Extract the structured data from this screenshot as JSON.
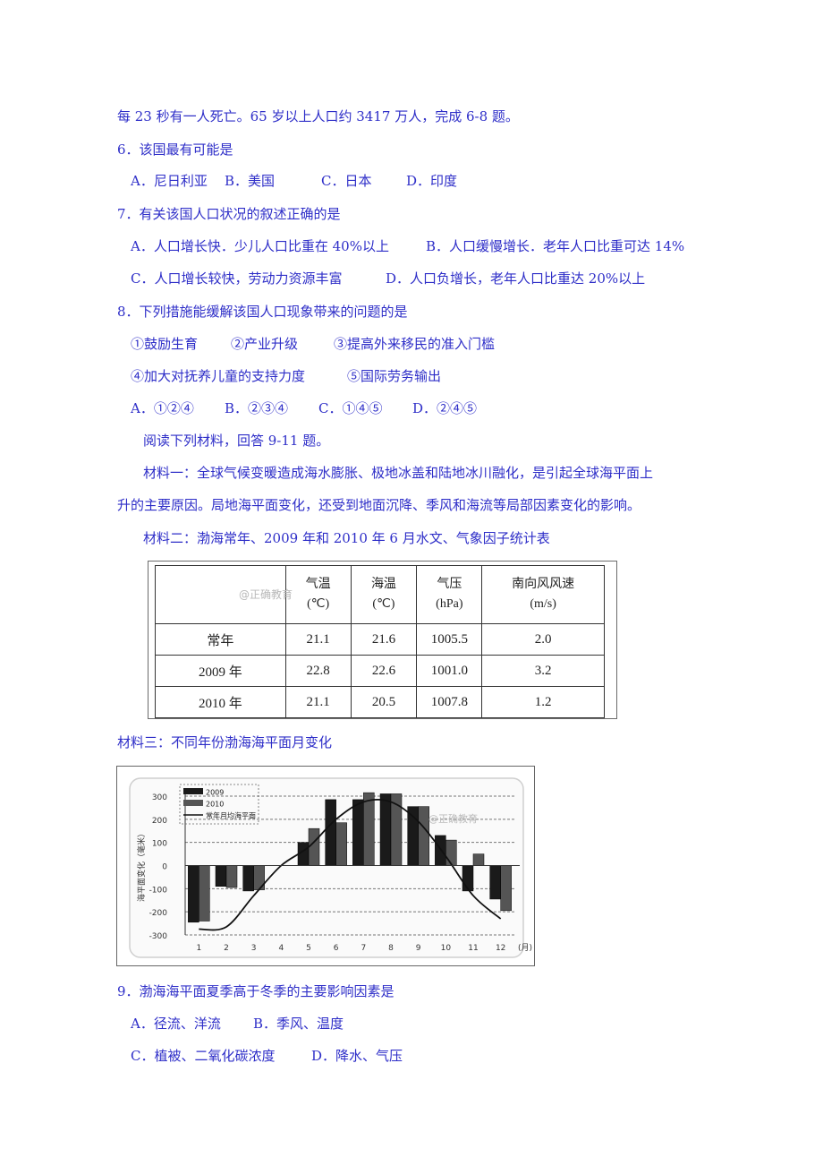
{
  "intro_line": "每 23 秒有一人死亡。65 岁以上人口约 3417 万人，完成 6-8 题。",
  "q6": {
    "stem": "6．该国最有可能是",
    "options": [
      "A．尼日利亚",
      "B．美国",
      "C．日本",
      "D．印度"
    ]
  },
  "q7": {
    "stem": "7．有关该国人口状况的叙述正确的是",
    "options": [
      "A．人口增长快．少儿人口比重在 40%以上",
      "B．人口缓慢增长．老年人口比重可达 14%",
      "C．人口增长较快，劳动力资源丰富",
      "D．人口负增长，老年人口比重达 20%以上"
    ]
  },
  "q8": {
    "stem": "8．下列措施能缓解该国人口现象带来的问题的是",
    "measures_row1": [
      "①鼓励生育",
      "②产业升级",
      "③提高外来移民的准入门槛"
    ],
    "measures_row2": [
      "④加大对抚养儿童的支持力度",
      "⑤国际劳务输出"
    ],
    "options": [
      "A．①②④",
      "B．②③④",
      "C．①④⑤",
      "D．②④⑤"
    ]
  },
  "reading_prompt": "阅读下列材料，回答 9-11 题。",
  "material1": {
    "line1": "材料一：全球气候变暖造成海水膨胀、极地冰盖和陆地冰川融化，是引起全球海平面上",
    "line2": "升的主要原因。局地海平面变化，还受到地面沉降、季风和海流等局部因素变化的影响。"
  },
  "material2": {
    "title": "材料二：渤海常年、2009 年和 2010 年 6 月水文、气象因子统计表",
    "watermark": "@正确教育",
    "headers": [
      {
        "name": "气温",
        "unit": "(℃)"
      },
      {
        "name": "海温",
        "unit": "(℃)"
      },
      {
        "name": "气压",
        "unit": "(hPa)"
      },
      {
        "name": "南向风风速",
        "unit": "(m/s)"
      }
    ],
    "rows": [
      {
        "label": "常年",
        "values": [
          "21.1",
          "21.6",
          "1005.5",
          "2.0"
        ]
      },
      {
        "label": "2009 年",
        "values": [
          "22.8",
          "22.6",
          "1001.0",
          "3.2"
        ]
      },
      {
        "label": "2010 年",
        "values": [
          "21.1",
          "20.5",
          "1007.8",
          "1.2"
        ]
      }
    ]
  },
  "material3": {
    "title": "材料三：不同年份渤海海平面月变化"
  },
  "chart_data": {
    "type": "bar",
    "title": "不同年份渤海海平面月变化",
    "xlabel": "(月)",
    "ylabel": "海平面变化（毫米）",
    "categories": [
      "1",
      "2",
      "3",
      "4",
      "5",
      "6",
      "7",
      "8",
      "9",
      "10",
      "11",
      "12"
    ],
    "ylim": [
      -300,
      300
    ],
    "yticks": [
      "300",
      "200",
      "100",
      "0",
      "-100",
      "-200",
      "-300"
    ],
    "grid": true,
    "legend_position": "top-left",
    "watermark": "@正确教育",
    "series": [
      {
        "name": "2009",
        "kind": "bar",
        "color": "#1a1a1a",
        "values": [
          -245,
          -90,
          -110,
          0,
          100,
          285,
          285,
          310,
          255,
          130,
          -110,
          -145
        ]
      },
      {
        "name": "2010",
        "kind": "bar",
        "color": "#555555",
        "values": [
          -240,
          -95,
          -105,
          0,
          160,
          185,
          315,
          310,
          255,
          110,
          50,
          -195
        ]
      },
      {
        "name": "常年月均海平面",
        "kind": "line",
        "color": "#111111",
        "values": [
          -275,
          -265,
          -130,
          0,
          80,
          200,
          275,
          275,
          190,
          40,
          -130,
          -230
        ]
      }
    ]
  },
  "q9": {
    "stem": "9．渤海海平面夏季高于冬季的主要影响因素是",
    "options": [
      "A．径流、洋流",
      "B．季风、温度",
      "C．植被、二氧化碳浓度",
      "D．降水、气压"
    ]
  }
}
